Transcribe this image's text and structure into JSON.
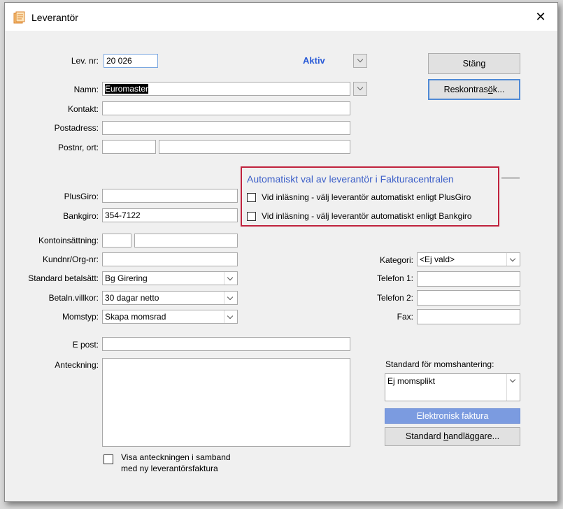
{
  "window": {
    "title": "Leverantör",
    "close_glyph": "✕"
  },
  "form": {
    "lev_nr": {
      "label": "Lev. nr:",
      "value": "20 026"
    },
    "status": "Aktiv",
    "namn": {
      "label": "Namn:",
      "value": "Euromaster"
    },
    "kontakt": {
      "label": "Kontakt:",
      "value": ""
    },
    "postadress": {
      "label": "Postadress:",
      "value": ""
    },
    "postnr_ort": {
      "label": "Postnr, ort:",
      "postnr": "",
      "ort": ""
    },
    "plusgiro": {
      "label": "PlusGiro:",
      "value": ""
    },
    "bankgiro": {
      "label": "Bankgiro:",
      "value": "354-7122"
    },
    "kontoinsattning": {
      "label": "Kontoinsättning:",
      "clearing": "",
      "konto": ""
    },
    "kundnr": {
      "label": "Kundnr/Org-nr:",
      "value": ""
    },
    "betalsatt": {
      "label": "Standard betalsätt:",
      "value": "Bg Girering"
    },
    "betalnvillkor": {
      "label": "Betaln.villkor:",
      "value": "30 dagar netto"
    },
    "momstyp": {
      "label": "Momstyp:",
      "value": "Skapa momsrad"
    },
    "epost": {
      "label": "E post:",
      "value": ""
    },
    "anteckning": {
      "label": "Anteckning:",
      "value": ""
    },
    "visa_anteckning": {
      "line1": "Visa anteckningen i samband",
      "line2": "med ny leverantörsfaktura",
      "checked": false
    },
    "kategori": {
      "label": "Kategori:",
      "value": "<Ej vald>"
    },
    "telefon1": {
      "label": "Telefon 1:",
      "value": ""
    },
    "telefon2": {
      "label": "Telefon 2:",
      "value": ""
    },
    "fax": {
      "label": "Fax:",
      "value": ""
    },
    "momshantering": {
      "label": "Standard för momshantering:",
      "value": "Ej momsplikt"
    }
  },
  "auto_group": {
    "title": "Automatiskt val av leverantör i Fakturacentralen",
    "option_plusgiro": "Vid inläsning - välj leverantör automatiskt enligt PlusGiro",
    "option_bankgiro": "Vid inläsning - välj leverantör automatiskt enligt Bankgiro",
    "border_color": "#c0223d",
    "title_color": "#3c5fc8"
  },
  "buttons": {
    "stang": "Stäng",
    "reskontra_pre": "Reskontras",
    "reskontra_accel": "ö",
    "reskontra_post": "k...",
    "elektronisk_faktura": "Elektronisk faktura",
    "handlaggare_pre": "Standard ",
    "handlaggare_accel": "h",
    "handlaggare_post": "andläggare..."
  },
  "colors": {
    "status_blue": "#2a5bd7",
    "selection_bg": "#000000",
    "primary_button": "#7b9be0"
  }
}
